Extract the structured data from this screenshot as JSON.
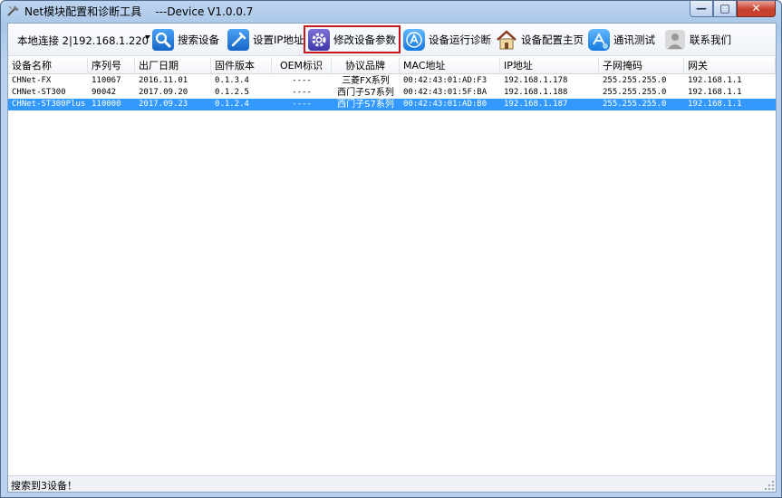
{
  "window": {
    "title": "Net模块配置和诊断工具    ---Device V1.0.0.7",
    "caption": {
      "minimize": "—",
      "maximize": "□",
      "close": "✕"
    }
  },
  "toolbar": {
    "connection": {
      "value": "本地连接 2|192.168.1.220"
    },
    "buttons": [
      {
        "label": "搜索设备",
        "icon": "search-icon"
      },
      {
        "label": "设置IP地址",
        "icon": "ip-settings-icon"
      },
      {
        "label": "修改设备参数",
        "icon": "gear-icon",
        "selected": true
      },
      {
        "label": "设备运行诊断",
        "icon": "diagnose-icon"
      },
      {
        "label": "设备配置主页",
        "icon": "home-icon"
      },
      {
        "label": "通讯测试",
        "icon": "comm-test-icon"
      },
      {
        "label": "联系我们",
        "icon": "contact-icon"
      }
    ]
  },
  "table": {
    "headers": [
      "设备名称",
      "序列号",
      "出厂日期",
      "固件版本",
      "OEM标识",
      "协议品牌",
      "MAC地址",
      "IP地址",
      "子网掩码",
      "网关"
    ],
    "rows": [
      [
        "CHNet-FX",
        "110067",
        "2016.11.01",
        "0.1.3.4",
        "----",
        "三菱FX系列",
        "00:42:43:01:AD:F3",
        "192.168.1.178",
        "255.255.255.0",
        "192.168.1.1"
      ],
      [
        "CHNet-ST300",
        "90042",
        "2017.09.20",
        "0.1.2.5",
        "----",
        "西门子S7系列",
        "00:42:43:01:5F:BA",
        "192.168.1.188",
        "255.255.255.0",
        "192.168.1.1"
      ],
      [
        "CHNet-ST300Plus",
        "110000",
        "2017.09.23",
        "0.1.2.4",
        "----",
        "西门子S7系列",
        "00:42:43:01:AD:B0",
        "192.168.1.187",
        "255.255.255.0",
        "192.168.1.1"
      ]
    ],
    "selected_row": 2
  },
  "status": {
    "text": "搜索到3设备！"
  },
  "colors": {
    "selection": "#3399ff",
    "highlight_border": "#c8161d"
  }
}
